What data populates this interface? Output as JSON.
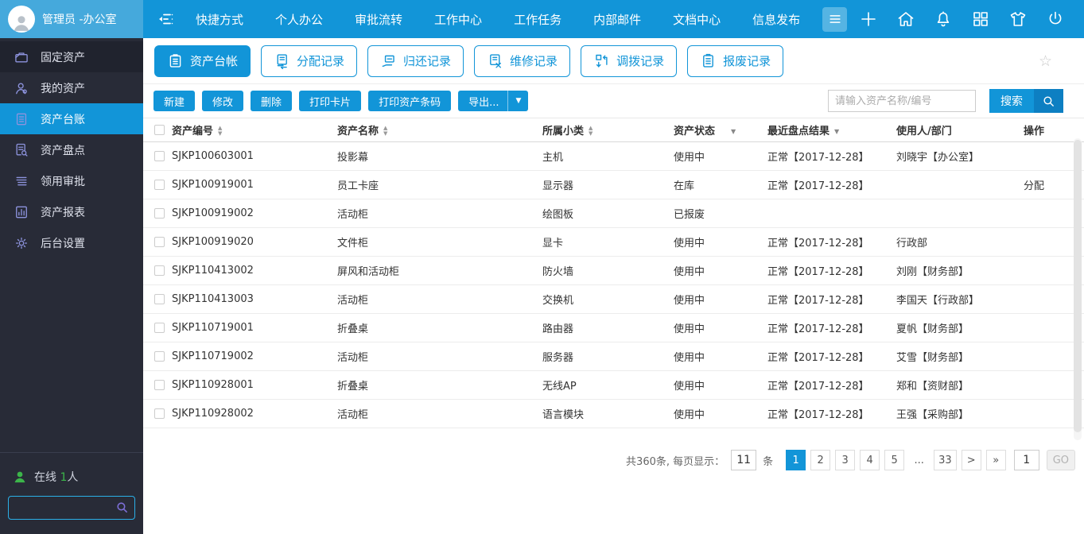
{
  "colors": {
    "accent": "#1295d8",
    "topbar_user_bg": "#45a9dc",
    "sidebar_bg": "#282b37",
    "sidebar_active": "#1295d8",
    "online_green": "#3cb54a",
    "search_border": "#2bb0e8",
    "search_btn_dark": "#0d7fc2",
    "text": "#333333"
  },
  "topbar": {
    "user_name": "管理员 -办公室",
    "nav": [
      "快捷方式",
      "个人办公",
      "审批流转",
      "工作中心",
      "工作任务",
      "内部邮件",
      "文档中心",
      "信息发布"
    ],
    "icons": [
      "plus-icon",
      "home-icon",
      "bell-icon",
      "apps-icon",
      "shirt-icon",
      "power-icon"
    ]
  },
  "sidebar": {
    "items": [
      {
        "label": "固定资产",
        "icon": "briefcase-icon",
        "type": "header"
      },
      {
        "label": "我的资产",
        "icon": "user-icon"
      },
      {
        "label": "资产台账",
        "icon": "ledger-icon",
        "active": true
      },
      {
        "label": "资产盘点",
        "icon": "inventory-icon"
      },
      {
        "label": "领用审批",
        "icon": "approval-icon"
      },
      {
        "label": "资产报表",
        "icon": "report-icon"
      },
      {
        "label": "后台设置",
        "icon": "settings-icon"
      }
    ],
    "online_label": "在线",
    "online_count": "1",
    "online_suffix": "人"
  },
  "tabs": [
    {
      "label": "资产台帐",
      "icon": "clipboard-icon",
      "active": true
    },
    {
      "label": "分配记录",
      "icon": "assign-icon"
    },
    {
      "label": "归还记录",
      "icon": "return-icon"
    },
    {
      "label": "维修记录",
      "icon": "repair-icon"
    },
    {
      "label": "调拨记录",
      "icon": "transfer-icon"
    },
    {
      "label": "报废记录",
      "icon": "scrap-icon"
    }
  ],
  "toolbar": {
    "buttons": [
      "新建",
      "修改",
      "删除",
      "打印卡片",
      "打印资产条码"
    ],
    "export_label": "导出...",
    "search_placeholder": "请输入资产名称/编号",
    "search_label": "搜索"
  },
  "table": {
    "columns": [
      {
        "label": "资产编号",
        "sort": "both"
      },
      {
        "label": "资产名称",
        "sort": "both"
      },
      {
        "label": "所属小类",
        "sort": "both"
      },
      {
        "label": "资产状态",
        "sort": "filter"
      },
      {
        "label": "最近盘点结果",
        "sort": "filter"
      },
      {
        "label": "使用人/部门",
        "sort": "none"
      },
      {
        "label": "操作",
        "sort": "none"
      }
    ],
    "rows": [
      {
        "code": "SJKP100603001",
        "name": "投影幕",
        "category": "主机",
        "status": "使用中",
        "check": "正常【2017-12-28】",
        "user": "刘晓宇【办公室】",
        "action": ""
      },
      {
        "code": "SJKP100919001",
        "name": "员工卡座",
        "category": "显示器",
        "status": "在库",
        "check": "正常【2017-12-28】",
        "user": "",
        "action": "分配"
      },
      {
        "code": "SJKP100919002",
        "name": "活动柜",
        "category": "绘图板",
        "status": "已报废",
        "check": "",
        "user": "",
        "action": ""
      },
      {
        "code": "SJKP100919020",
        "name": "文件柜",
        "category": "显卡",
        "status": "使用中",
        "check": "正常【2017-12-28】",
        "user": "行政部",
        "action": ""
      },
      {
        "code": "SJKP110413002",
        "name": "屏风和活动柜",
        "category": "防火墙",
        "status": "使用中",
        "check": "正常【2017-12-28】",
        "user": "刘刚【财务部】",
        "action": ""
      },
      {
        "code": "SJKP110413003",
        "name": "活动柜",
        "category": "交换机",
        "status": "使用中",
        "check": "正常【2017-12-28】",
        "user": "李国天【行政部】",
        "action": ""
      },
      {
        "code": "SJKP110719001",
        "name": "折叠桌",
        "category": "路由器",
        "status": "使用中",
        "check": "正常【2017-12-28】",
        "user": "夏帆【财务部】",
        "action": ""
      },
      {
        "code": "SJKP110719002",
        "name": "活动柜",
        "category": "服务器",
        "status": "使用中",
        "check": "正常【2017-12-28】",
        "user": "艾雪【财务部】",
        "action": ""
      },
      {
        "code": "SJKP110928001",
        "name": "折叠桌",
        "category": "无线AP",
        "status": "使用中",
        "check": "正常【2017-12-28】",
        "user": "郑和【资财部】",
        "action": ""
      },
      {
        "code": "SJKP110928002",
        "name": "活动柜",
        "category": "语言模块",
        "status": "使用中",
        "check": "正常【2017-12-28】",
        "user": "王强【采购部】",
        "action": ""
      }
    ]
  },
  "pagination": {
    "total_label": "共360条, 每页显示：",
    "page_size": "11",
    "unit": "条",
    "pages": [
      "1",
      "2",
      "3",
      "4",
      "5",
      "...",
      "33",
      ">",
      "»"
    ],
    "active_page": "1",
    "goto_value": "1",
    "go_label": "GO"
  },
  "glyphs": {
    "sort_asc": "▲",
    "sort_desc": "▼",
    "filter_caret": "▼",
    "export_caret": "▼",
    "star": "☆"
  }
}
